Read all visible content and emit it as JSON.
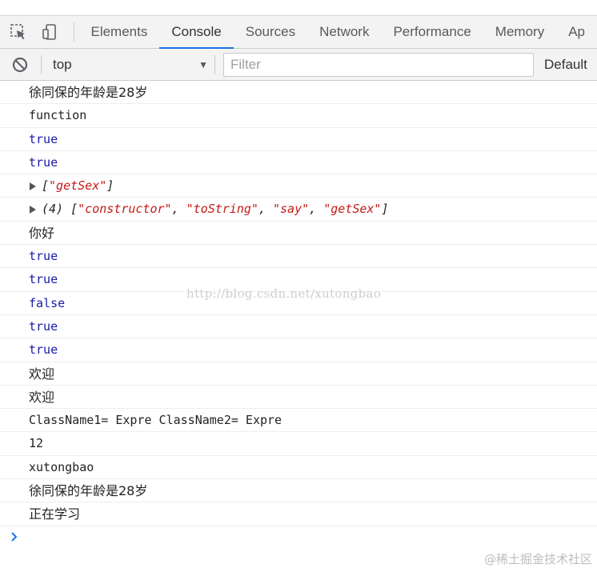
{
  "tabs": [
    "Elements",
    "Console",
    "Sources",
    "Network",
    "Performance",
    "Memory",
    "Ap"
  ],
  "active_tab": "Console",
  "icons": {
    "inspect": "inspect-element-icon",
    "device": "device-toolbar-icon",
    "clear": "clear-console-icon",
    "dropdown": "dropdown-caret-icon",
    "expand": "expand-triangle-icon",
    "prompt": "prompt-chevron-icon"
  },
  "toolbar": {
    "context": "top",
    "filter_placeholder": "Filter",
    "levels": "Default"
  },
  "messages": [
    {
      "text": "徐同保的年龄是28岁"
    },
    {
      "text": "function"
    },
    {
      "text": "true"
    },
    {
      "text": "true"
    },
    {
      "arr_prefix": "[",
      "items": [
        "\"getSex\""
      ],
      "arr_suffix": "]"
    },
    {
      "count": "(4)",
      "arr_prefix": "[",
      "items": [
        "\"constructor\"",
        "\"toString\"",
        "\"say\"",
        "\"getSex\""
      ],
      "arr_suffix": "]"
    },
    {
      "text": "你好"
    },
    {
      "text": "true"
    },
    {
      "text": "true"
    },
    {
      "text": "false"
    },
    {
      "text": "true"
    },
    {
      "text": "true"
    },
    {
      "text": "欢迎"
    },
    {
      "text": "欢迎"
    },
    {
      "text": "ClassName1= Expre ClassName2= Expre"
    },
    {
      "text": "12"
    },
    {
      "text": "xutongbao"
    },
    {
      "text": "徐同保的年龄是28岁"
    },
    {
      "text": "正在学习"
    }
  ],
  "watermark": "http://blog.csdn.net/xutongbao",
  "footer_mark": "@稀土掘金技术社区",
  "colors": {
    "accent": "#1a73e8",
    "boolean": "#1a1aa6",
    "string": "#c41a16"
  }
}
